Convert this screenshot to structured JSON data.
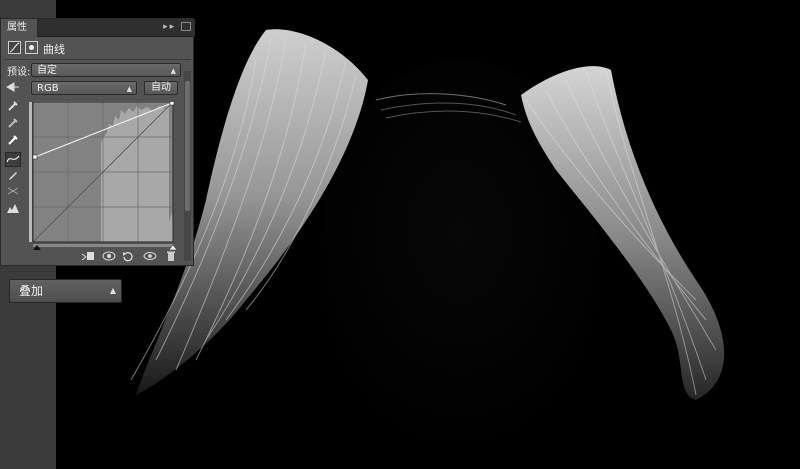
{
  "panel": {
    "tab_label": "属性",
    "collapse_glyph": "▸▸",
    "title": "曲线",
    "preset_label": "预设:",
    "preset_value": "自定",
    "channel_value": "RGB",
    "auto_label": "自动"
  },
  "tools": [
    "sample-in-image-icon",
    "black-point-eyedropper-icon",
    "gray-point-eyedropper-icon",
    "white-point-eyedropper-icon",
    "edit-points-curve-icon",
    "draw-curve-pencil-icon",
    "smooth-curve-icon",
    "clipping-warning-icon"
  ],
  "bottom_icons": [
    "clip-to-layer-icon",
    "view-previous-state-icon",
    "reset-icon",
    "visibility-eye-icon",
    "delete-trash-icon"
  ],
  "blend_mode": {
    "value": "叠加"
  },
  "colors": {
    "panel_bg": "#535353",
    "topbar_bg": "#2f2f2f",
    "canvas_bg": "#000000"
  }
}
